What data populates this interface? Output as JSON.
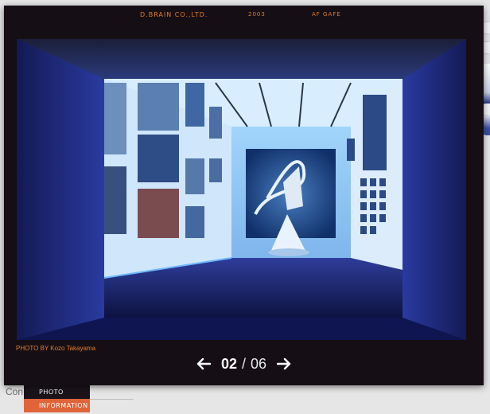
{
  "header": {
    "company": "D.BRAIN CO.,LTD.",
    "year": "2003",
    "title": "AF GAFE"
  },
  "photo": {
    "caption": "PHOTO BY Kozo Takayama"
  },
  "pager": {
    "current": "02",
    "separator": "/",
    "total": "06"
  },
  "background": {
    "partial_text": "Con",
    "nav": {
      "photo": "PHOTO",
      "information": "INFORMATION"
    }
  },
  "colors": {
    "accent": "#e47a22",
    "lightbox_bg": "#150f15",
    "info_tab": "#e0643a"
  }
}
